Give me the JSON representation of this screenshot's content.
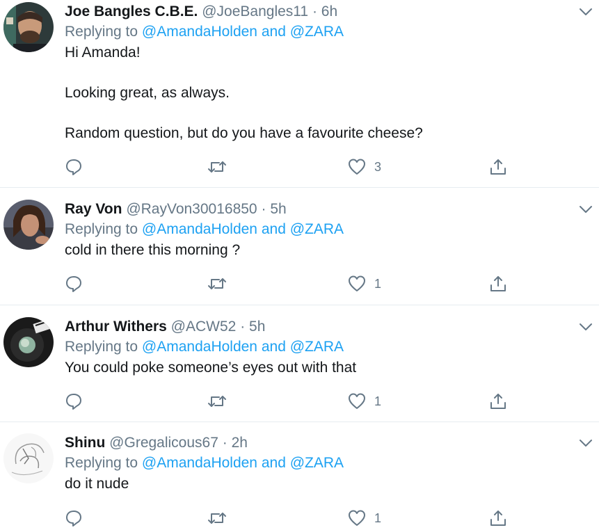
{
  "colors": {
    "link": "#1da1f2",
    "secondary_text": "#657786",
    "primary_text": "#14171a",
    "divider": "#e6ecf0"
  },
  "icons": {
    "reply": "reply-icon",
    "retweet": "retweet-icon",
    "like": "heart-icon",
    "share": "share-icon",
    "menu": "chevron-down-icon"
  },
  "tweets": [
    {
      "name": "Joe Bangles C.B.E.",
      "handle": "@JoeBangles11",
      "dot": "·",
      "time": "6h",
      "replying_prefix": "Replying to",
      "mention_1": "@AmandaHolden",
      "and": "and",
      "mention_2": "@ZARA",
      "text": [
        "Hi Amanda!",
        "Looking great, as always.",
        "Random question, but do you have a favourite cheese?"
      ],
      "likes": "3"
    },
    {
      "name": "Ray Von",
      "handle": "@RayVon30016850",
      "dot": "·",
      "time": "5h",
      "replying_prefix": "Replying to",
      "mention_1": "@AmandaHolden",
      "and": "and",
      "mention_2": "@ZARA",
      "text": [
        "cold in there this morning ?"
      ],
      "likes": "1"
    },
    {
      "name": "Arthur Withers",
      "handle": "@ACW52",
      "dot": "·",
      "time": "5h",
      "replying_prefix": "Replying to",
      "mention_1": "@AmandaHolden",
      "and": "and",
      "mention_2": "@ZARA",
      "text": [
        "You could poke someone’s eyes out with that"
      ],
      "likes": "1"
    },
    {
      "name": "Shinu",
      "handle": "@Gregalicous67",
      "dot": "·",
      "time": "2h",
      "replying_prefix": "Replying to",
      "mention_1": "@AmandaHolden",
      "and": "and",
      "mention_2": "@ZARA",
      "text": [
        "do it nude"
      ],
      "likes": "1"
    }
  ]
}
